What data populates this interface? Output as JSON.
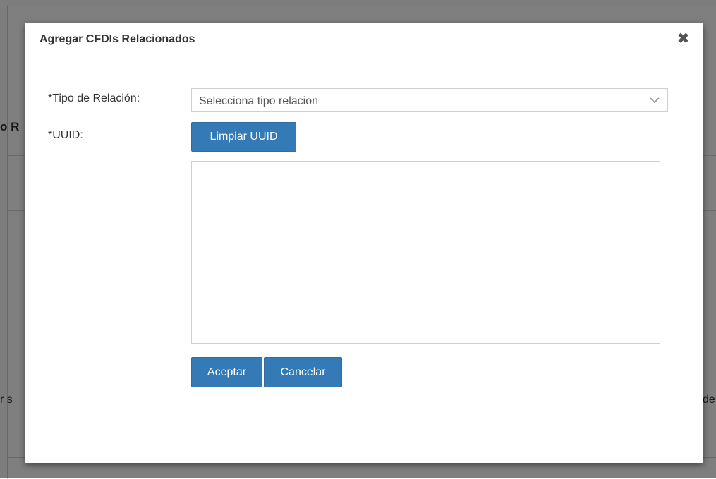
{
  "background": {
    "partial_heading": "o R",
    "partial_text_left": "r s",
    "partial_text_right": "de"
  },
  "modal": {
    "title": "Agregar CFDIs Relacionados",
    "close_symbol": "✖"
  },
  "form": {
    "tipo_label": "*Tipo de Relación:",
    "tipo_select": {
      "selected": "Selecciona tipo relacion"
    },
    "uuid_label": "*UUID:",
    "limpiar_label": "Limpiar UUID",
    "uuid_textarea": {
      "value": "",
      "placeholder": ""
    }
  },
  "actions": {
    "aceptar_label": "Aceptar",
    "cancelar_label": "Cancelar"
  },
  "colors": {
    "primary": "#337ab7",
    "overlay": "rgba(0,0,0,0.5)"
  }
}
